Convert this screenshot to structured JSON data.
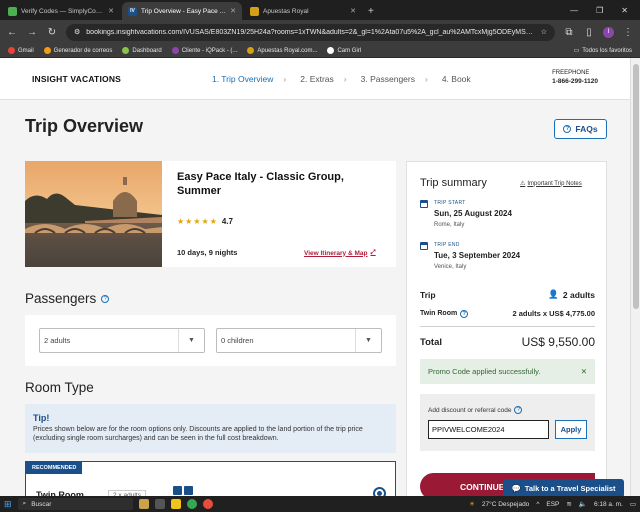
{
  "browser": {
    "tabs": [
      {
        "label": "Verify Codes — SimplyCodes",
        "icon": "simplycodes-icon",
        "active": false
      },
      {
        "label": "Trip Overview - Easy Pace Italy",
        "icon": "iv-icon",
        "active": true,
        "favicon_text": "IV"
      },
      {
        "label": "Apuestas Royal",
        "icon": "royal-icon",
        "active": false
      }
    ],
    "new_tab": "+",
    "url": "bookings.insightvacations.com/IVUSAS/E803ZN19/25H24a?rooms=1xTWN&adults=2&_gl=1%2Ata07u5%2A_gcl_au%2AMTcxMjg5ODEyMS4xNzI...",
    "profile_initial": "I",
    "bookmarks": [
      "Gmail",
      "Generador de correos",
      "Dashboard",
      "Cliente - iQPack - (...",
      "Apuestas Royal.com...",
      "Cam Girl"
    ],
    "bookmarks_right": "Todos los favoritos"
  },
  "site": {
    "logo": "INSIGHT VACATIONS",
    "steps": [
      {
        "label": "1. Trip Overview",
        "active": true
      },
      {
        "label": "2. Extras",
        "active": false
      },
      {
        "label": "3. Passengers",
        "active": false
      },
      {
        "label": "4. Book",
        "active": false
      }
    ],
    "phone_label": "FREEPHONE",
    "phone_number": "1-866-299-1120"
  },
  "page": {
    "title": "Trip Overview",
    "faq_label": "FAQs"
  },
  "trip": {
    "name": "Easy Pace Italy - Classic Group, Summer",
    "rating": "4.7",
    "stars": 4.7,
    "duration": "10 days, 9 nights",
    "itinerary_link": "View Itinerary & Map"
  },
  "passengers": {
    "title": "Passengers",
    "adults": "2 adults",
    "children": "0 children"
  },
  "room_type": {
    "title": "Room Type",
    "tip_title": "Tip!",
    "tip_text": "Prices shown below are for the room options only. Discounts are applied to the land portion of the trip price (excluding single room surcharges) and can be seen in the full cost breakdown.",
    "badge": "RECOMMENDED",
    "room_name": "Twin Room",
    "room_adults": "2 x adults"
  },
  "summary": {
    "title": "Trip summary",
    "important_link": "Important Trip Notes",
    "start_label": "TRIP START",
    "start_date": "Sun, 25 August 2024",
    "start_place": "Rome, Italy",
    "end_label": "TRIP END",
    "end_date": "Tue, 3 September 2024",
    "end_place": "Venice, Italy",
    "trip_label": "Trip",
    "trip_pax": "2 adults",
    "room_label": "Twin Room",
    "room_price": "2 adults x US$ 4,775.00",
    "total_label": "Total",
    "total_value": "US$ 9,550.00",
    "promo_applied": "Promo Code applied successfully.",
    "promo_label": "Add discount or referral code",
    "promo_code": "PPIVWELCOME2024",
    "apply_label": "Apply",
    "continue_label": "CONTINUE"
  },
  "chat_label": "Talk to a Travel Specialist",
  "taskbar": {
    "search": "Buscar",
    "weather": "27°C  Despejado",
    "lang": "ESP",
    "time": "6:18 a. m."
  },
  "colors": {
    "brand_blue": "#1a4f8a",
    "link_blue": "#1a6fb5",
    "cta_red": "#9a1a36",
    "star": "#e5a400",
    "promo_green_bg": "#e6efe6"
  }
}
